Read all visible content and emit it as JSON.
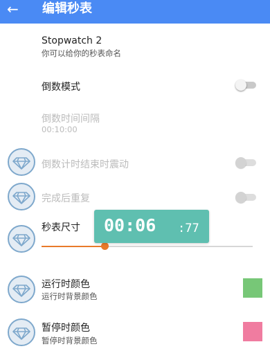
{
  "appbar": {
    "title": "编辑秒表",
    "back_icon": "arrow-back-icon"
  },
  "name_setting": {
    "title": "Stopwatch 2",
    "subtitle": "你可以给你的秒表命名"
  },
  "countdown_mode": {
    "label": "倒数模式",
    "enabled": false
  },
  "countdown_interval": {
    "label": "倒数时间间隔",
    "value": "00:10:00",
    "disabled": true
  },
  "vibrate_on_end": {
    "label": "倒数计时结束时震动",
    "enabled": false,
    "disabled": true,
    "badge_icon": "diamond-premium-icon"
  },
  "repeat_after_finish": {
    "label": "完成后重复",
    "enabled": false,
    "disabled": true,
    "badge_icon": "diamond-premium-icon"
  },
  "stopwatch_size": {
    "label": "秒表尺寸",
    "badge_icon": "diamond-premium-icon",
    "slider_fraction": 0.3,
    "preview": {
      "main": "00:06",
      "ms": ":77"
    }
  },
  "running_color": {
    "title": "运行时颜色",
    "subtitle": "运行时背景颜色",
    "swatch": "#77c777",
    "badge_icon": "diamond-premium-icon"
  },
  "paused_color": {
    "title": "暂停时颜色",
    "subtitle": "暂停时背景颜色",
    "swatch": "#f07ca0",
    "badge_icon": "diamond-premium-icon"
  },
  "colors": {
    "appbar": "#4a8af4",
    "accent": "#e87a2a",
    "popup": "#5fbfb0"
  }
}
